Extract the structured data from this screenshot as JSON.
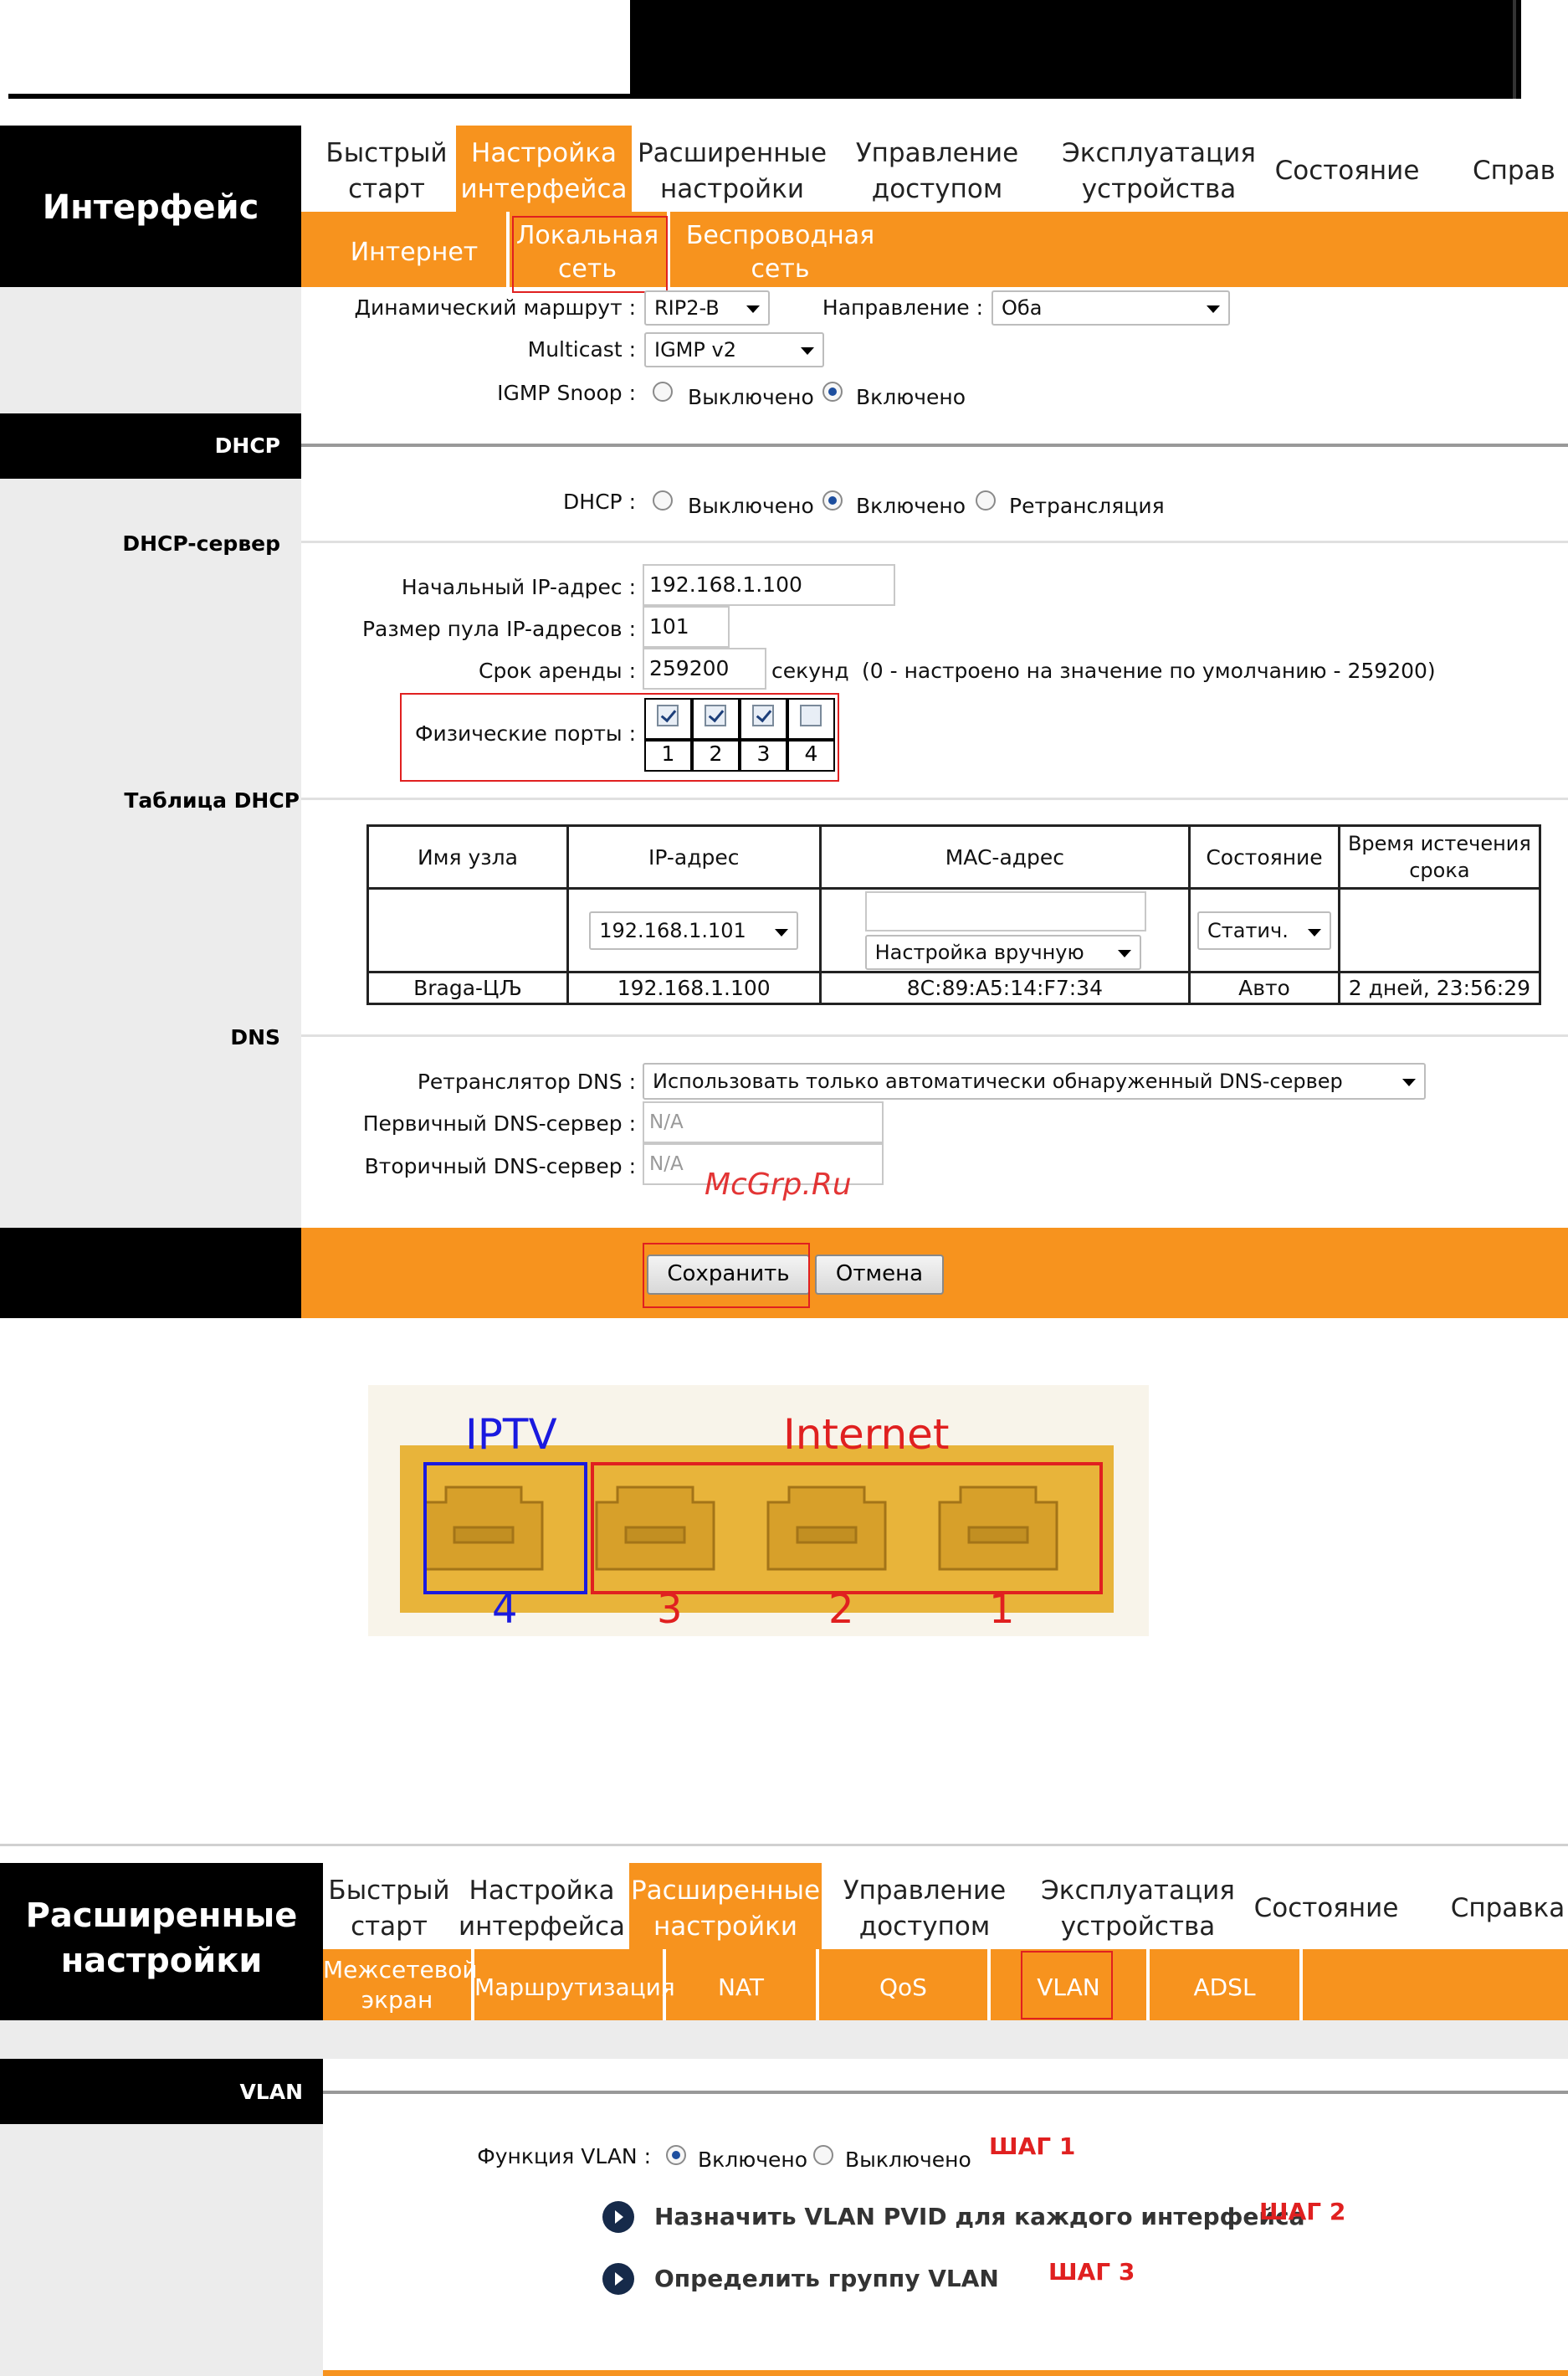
{
  "screen1": {
    "sidebar_title": "Интерфейс",
    "tabs": [
      {
        "line1": "Быстрый",
        "line2": "старт"
      },
      {
        "line1": "Настройка",
        "line2": "интерфейса"
      },
      {
        "line1": "Расширенные",
        "line2": "настройки"
      },
      {
        "line1": "Управление",
        "line2": "доступом"
      },
      {
        "line1": "Эксплуатация",
        "line2": "устройства"
      },
      {
        "line1": "Состояние",
        "line2": ""
      },
      {
        "line1": "Справ",
        "line2": ""
      }
    ],
    "subtabs": [
      {
        "line1": "Интернет",
        "line2": ""
      },
      {
        "line1": "Локальная",
        "line2": "сеть"
      },
      {
        "line1": "Беспроводная",
        "line2": "сеть"
      }
    ],
    "routing": {
      "dynamic_route_label": "Динамический маршрут :",
      "dynamic_route_value": "RIP2-B",
      "direction_label": "Направление :",
      "direction_value": "Оба",
      "multicast_label": "Multicast :",
      "multicast_value": "IGMP v2",
      "igmp_label": "IGMP Snoop :",
      "igmp_off": "Выключено",
      "igmp_on": "Включено"
    },
    "dhcp_section": "DHCP",
    "dhcp": {
      "label": "DHCP :",
      "off": "Выключено",
      "on": "Включено",
      "relay": "Ретрансляция"
    },
    "dhcp_server_section": "DHCP-сервер",
    "server": {
      "start_ip_label": "Начальный IP-адрес :",
      "start_ip_value": "192.168.1.100",
      "pool_label": "Размер пула IP-адресов :",
      "pool_value": "101",
      "lease_label": "Срок аренды :",
      "lease_value": "259200",
      "lease_unit": "секунд",
      "lease_note": "(0 - настроено на значение по умолчанию - 259200)",
      "ports_label": "Физические порты :",
      "port_numbers": [
        "1",
        "2",
        "3",
        "4"
      ],
      "port_checked": [
        true,
        true,
        true,
        false
      ]
    },
    "dhcp_table_section": "Таблица DHCP",
    "table": {
      "headers": [
        "Имя узла",
        "IP-адрес",
        "MAC-адрес",
        "Состояние",
        "Время истечения срока"
      ],
      "edit_ip": "192.168.1.101",
      "edit_mac_mode": "Настройка вручную",
      "edit_state": "Статич.",
      "row": [
        "Braga-ЦЉ",
        "192.168.1.100",
        "8C:89:A5:14:F7:34",
        "Авто",
        "2 дней, 23:56:29"
      ]
    },
    "dns_section": "DNS",
    "dns": {
      "relay_label": "Ретранслятор DNS :",
      "relay_value": "Использовать только автоматически обнаруженный DNS-сервер",
      "primary_label": "Первичный DNS-сервер :",
      "primary_value": "N/A",
      "secondary_label": "Вторичный DNS-сервер :",
      "secondary_value": "N/A"
    },
    "watermark": "McGrp.Ru",
    "save_label": "Сохранить",
    "cancel_label": "Отмена"
  },
  "ports_photo": {
    "iptv_label": "IPTV",
    "internet_label": "Internet",
    "numbers": [
      "4",
      "3",
      "2",
      "1"
    ]
  },
  "screen2": {
    "sidebar_title_line1": "Расширенные",
    "sidebar_title_line2": "настройки",
    "tabs": [
      {
        "line1": "Быстрый",
        "line2": "старт"
      },
      {
        "line1": "Настройка",
        "line2": "интерфейса"
      },
      {
        "line1": "Расширенные",
        "line2": "настройки"
      },
      {
        "line1": "Управление",
        "line2": "доступом"
      },
      {
        "line1": "Эксплуатация",
        "line2": "устройства"
      },
      {
        "line1": "Состояние",
        "line2": ""
      },
      {
        "line1": "Справка",
        "line2": ""
      }
    ],
    "subtabs": [
      {
        "line1": "Межсетевой",
        "line2": "экран"
      },
      {
        "line1": "Маршрутизация",
        "line2": ""
      },
      {
        "line1": "NAT",
        "line2": ""
      },
      {
        "line1": "QoS",
        "line2": ""
      },
      {
        "line1": "VLAN",
        "line2": ""
      },
      {
        "line1": "ADSL",
        "line2": ""
      }
    ],
    "vlan_section": "VLAN",
    "vlan_function_label": "Функция VLAN :",
    "vlan_on": "Включено",
    "vlan_off": "Выключено",
    "step1": "ШАГ 1",
    "link1": "Назначить VLAN PVID для каждого интерфейса",
    "step2": "ШАГ 2",
    "link2": "Определить группу VLAN",
    "step3": "ШАГ 3"
  },
  "colors": {
    "orange": "#f7931e",
    "black": "#000000",
    "red_highlight": "#e02020",
    "iptv_blue": "#1a1adf",
    "internet_red": "#e02020",
    "port_yellow": "#e8b43a"
  }
}
